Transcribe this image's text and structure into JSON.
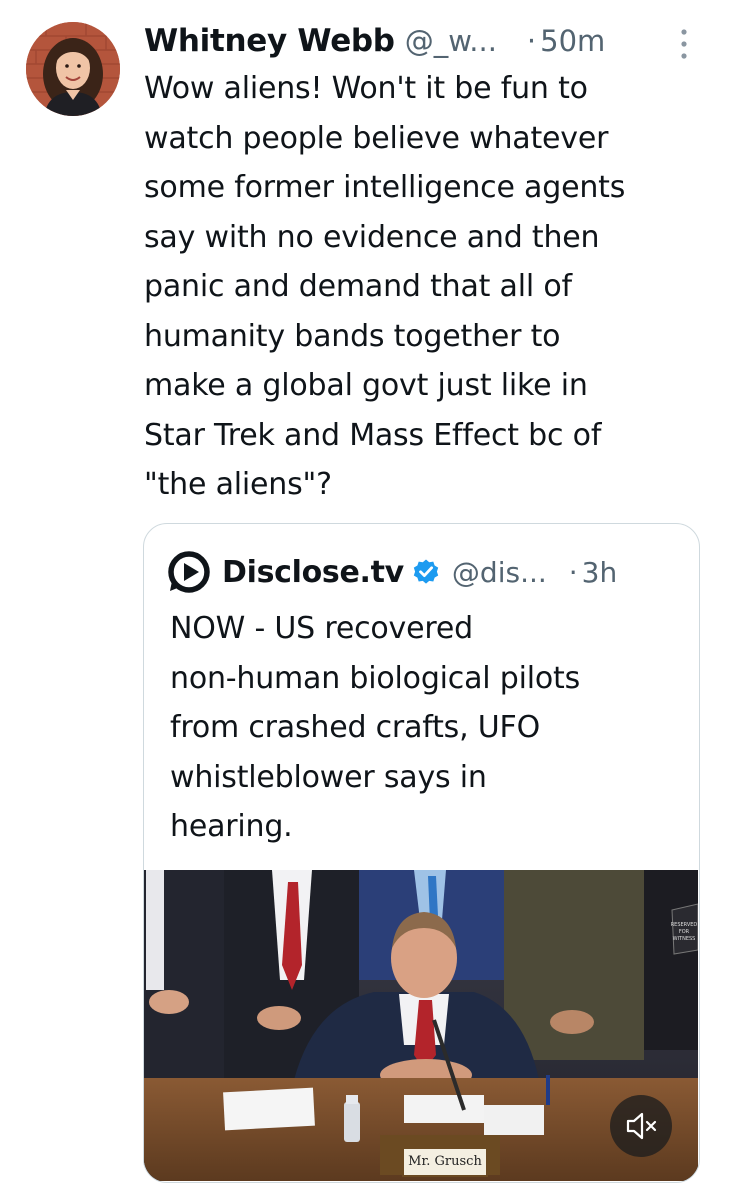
{
  "tweet": {
    "author": {
      "display_name": "Whitney Webb",
      "handle": "@_w...",
      "avatar_icon": "user-avatar-photo"
    },
    "separator": "·",
    "time": "50m",
    "more_icon": "more-vertical-icon",
    "text": "Wow aliens! Won't it be fun to\nwatch people believe whatever\nsome former intelligence agents\nsay with no evidence and then\npanic and demand that all of\nhumanity bands together to\nmake a global govt just like in\nStar Trek and Mass Effect bc of\n\"the aliens\"?"
  },
  "quoted_tweet": {
    "author": {
      "display_name": "Disclose.tv",
      "handle": "@dis...",
      "logo_icon": "disclose-tv-logo-icon",
      "verified_icon": "verified-badge-icon",
      "verified_color": "#1d9bf0"
    },
    "separator": "·",
    "time": "3h",
    "text": "NOW - US recovered\nnon-human biological pilots\nfrom crashed crafts, UFO\nwhistleblower says in\nhearing.",
    "media": {
      "type": "video",
      "nameplate": "Mr. Grusch",
      "sign_text": "RESERVED FOR WITNESS",
      "mute_icon": "volume-muted-icon"
    }
  },
  "colors": {
    "primary_text": "#0f1419",
    "secondary_text": "#536471",
    "border": "#cfd9de",
    "accent": "#1d9bf0"
  }
}
